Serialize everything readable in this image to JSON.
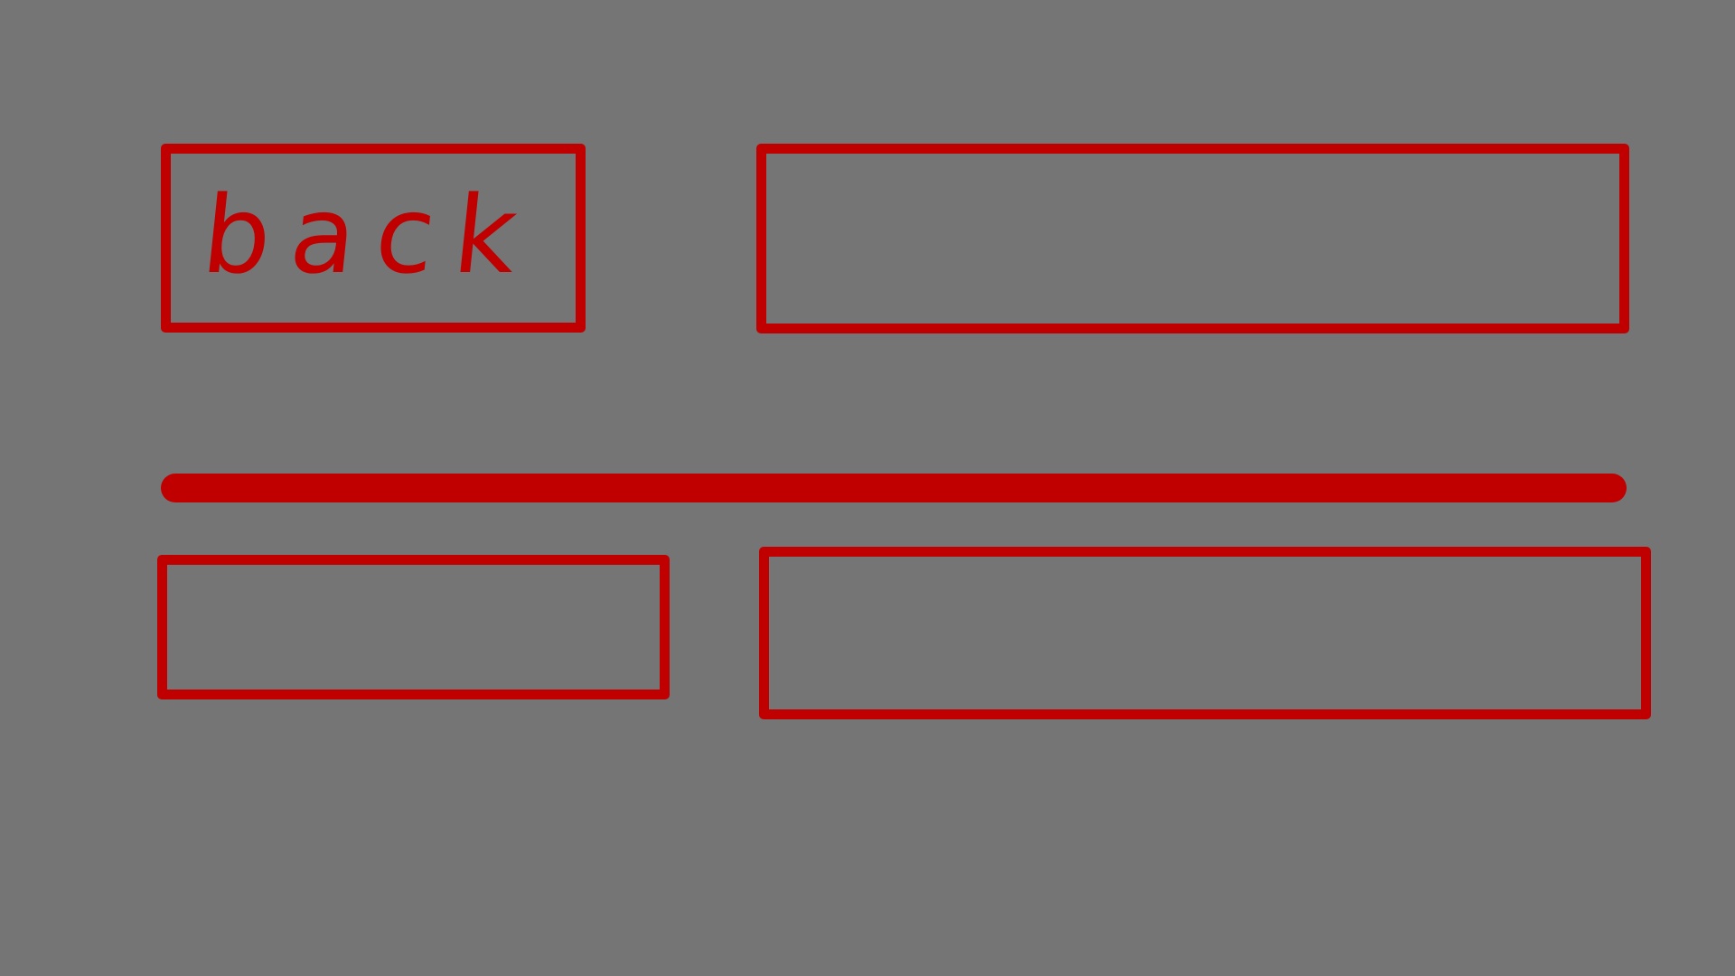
{
  "colors": {
    "background": "#757575",
    "sketch_stroke": "#c00000"
  },
  "top_row": {
    "back_button": {
      "label": "back"
    },
    "title_box": {
      "text": ""
    }
  },
  "bottom_row": {
    "left_box": {
      "text": ""
    },
    "right_box": {
      "text": ""
    }
  }
}
